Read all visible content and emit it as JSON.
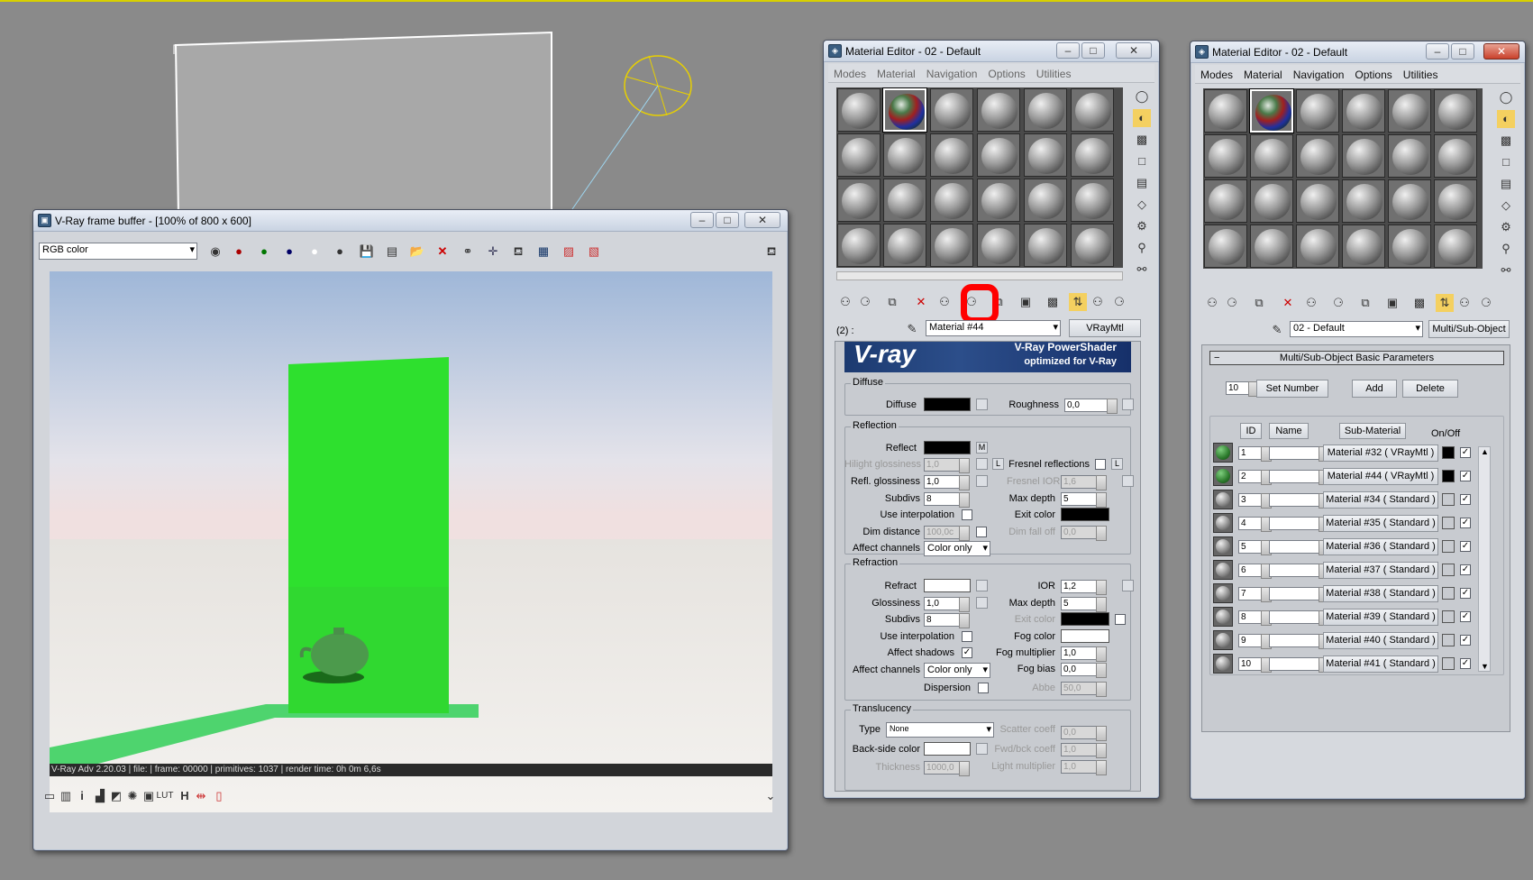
{
  "viewport": {
    "bg": "#8a8a8a"
  },
  "vfb": {
    "title": "V-Ray frame buffer - [100% of 800 x 600]",
    "channel": "RGB color",
    "status": "V-Ray Adv 2.20.03 | file:  | frame: 00000 | primitives: 1037 | render time:  0h  0m  6,6s"
  },
  "me1": {
    "title": "Material Editor - 02 - Default",
    "menu": [
      "Modes",
      "Material",
      "Navigation",
      "Options",
      "Utilities"
    ],
    "slot_label": "(2) :",
    "material_name": "Material #44",
    "material_type": "VRayMtl",
    "banner": {
      "logo": "V-ray",
      "line1": "V-Ray PowerShader",
      "line2": "optimized for V-Ray"
    },
    "diffuse": {
      "group": "Diffuse",
      "label": "Diffuse",
      "roughness_label": "Roughness",
      "roughness": "0,0"
    },
    "reflection": {
      "group": "Reflection",
      "reflect": "Reflect",
      "m": "M",
      "hilight_gloss": "Hilight glossiness",
      "hilight_val": "1,0",
      "l": "L",
      "fresnel": "Fresnel reflections",
      "fresnel_l": "L",
      "refl_gloss": "Refl. glossiness",
      "refl_gloss_val": "1,0",
      "fresnel_ior": "Fresnel IOR",
      "fresnel_ior_val": "1,6",
      "subdivs": "Subdivs",
      "subdivs_val": "8",
      "max_depth": "Max depth",
      "max_depth_val": "5",
      "use_interp": "Use interpolation",
      "exit_color": "Exit color",
      "dim_distance": "Dim distance",
      "dim_distance_val": "100,0c",
      "dim_falloff": "Dim fall off",
      "dim_falloff_val": "0,0",
      "affect_channels": "Affect channels",
      "affect_channels_val": "Color only"
    },
    "refraction": {
      "group": "Refraction",
      "refract": "Refract",
      "ior": "IOR",
      "ior_val": "1,2",
      "glossiness": "Glossiness",
      "glossiness_val": "1,0",
      "max_depth": "Max depth",
      "max_depth_val": "5",
      "subdivs": "Subdivs",
      "subdivs_val": "8",
      "exit_color": "Exit color",
      "use_interp": "Use interpolation",
      "fog_color": "Fog color",
      "affect_shadows": "Affect shadows",
      "fog_mult": "Fog multiplier",
      "fog_mult_val": "1,0",
      "affect_channels": "Affect channels",
      "affect_channels_val": "Color only",
      "fog_bias": "Fog bias",
      "fog_bias_val": "0,0",
      "dispersion": "Dispersion",
      "abbe": "Abbe",
      "abbe_val": "50,0"
    },
    "translucency": {
      "group": "Translucency",
      "type": "Type",
      "type_val": "None",
      "scatter": "Scatter coeff",
      "scatter_val": "0,0",
      "backside": "Back-side color",
      "fwd": "Fwd/bck coeff",
      "fwd_val": "1,0",
      "thickness": "Thickness",
      "thickness_val": "1000,0",
      "light_mult": "Light multiplier",
      "light_mult_val": "1,0"
    }
  },
  "me2": {
    "title": "Material Editor - 02 - Default",
    "menu": [
      "Modes",
      "Material",
      "Navigation",
      "Options",
      "Utilities"
    ],
    "material_name": "02 - Default",
    "material_type": "Multi/Sub-Object",
    "rollout": "Multi/Sub-Object Basic Parameters",
    "count": "10",
    "set_number": "Set Number",
    "add": "Add",
    "delete": "Delete",
    "headers": {
      "id": "ID",
      "name": "Name",
      "sub": "Sub-Material",
      "onoff": "On/Off"
    },
    "rows": [
      {
        "id": "1",
        "sub": "Material #32  ( VRayMtl )",
        "thumb": "g",
        "sw": "#000000"
      },
      {
        "id": "2",
        "sub": "Material #44  ( VRayMtl )",
        "thumb": "g",
        "sw": "#000000"
      },
      {
        "id": "3",
        "sub": "Material #34  ( Standard )",
        "thumb": "s",
        "sw": "#c8cbd0"
      },
      {
        "id": "4",
        "sub": "Material #35  ( Standard )",
        "thumb": "s",
        "sw": "#c8cbd0"
      },
      {
        "id": "5",
        "sub": "Material #36  ( Standard )",
        "thumb": "s",
        "sw": "#c8cbd0"
      },
      {
        "id": "6",
        "sub": "Material #37  ( Standard )",
        "thumb": "s",
        "sw": "#c8cbd0"
      },
      {
        "id": "7",
        "sub": "Material #38  ( Standard )",
        "thumb": "s",
        "sw": "#c8cbd0"
      },
      {
        "id": "8",
        "sub": "Material #39  ( Standard )",
        "thumb": "s",
        "sw": "#c8cbd0"
      },
      {
        "id": "9",
        "sub": "Material #40  ( Standard )",
        "thumb": "s",
        "sw": "#c8cbd0"
      },
      {
        "id": "10",
        "sub": "Material #41  ( Standard )",
        "thumb": "s",
        "sw": "#c8cbd0"
      }
    ]
  }
}
